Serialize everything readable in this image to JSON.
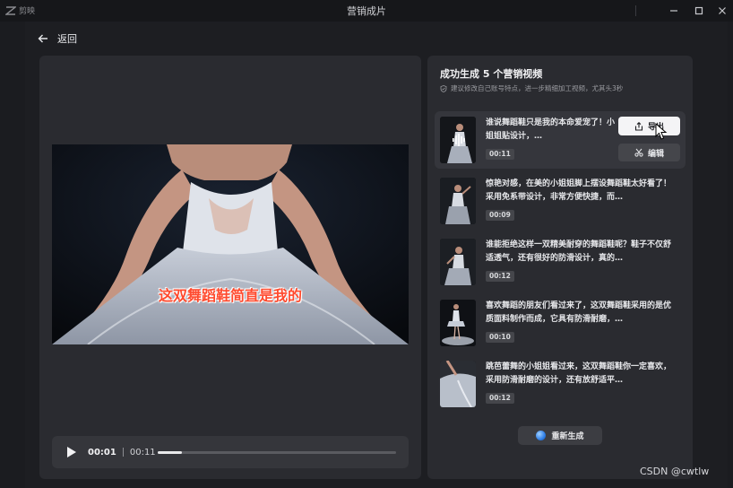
{
  "window": {
    "app_name": "剪映",
    "title": "营销成片",
    "controls": [
      "minimize-icon",
      "maximize-icon",
      "close-icon"
    ]
  },
  "nav": {
    "back_label": "返回"
  },
  "preview": {
    "subtitle": "这双舞蹈鞋简直是我的",
    "current_time": "00:01",
    "total_time": "00:11",
    "progress": 0.1
  },
  "results": {
    "title": "成功生成 5 个营销视频",
    "tip": "建议修改自己账号特点，进一步精细加工视频，尤其头3秒",
    "items": [
      {
        "text": "谁说舞蹈鞋只是我的本命爱宠了！小姐姐贴设计，…",
        "duration": "00:11",
        "active": true
      },
      {
        "text": "惊艳对感，在美的小姐姐脚上摆设舞蹈鞋太好看了！采用免系带设计，非常方便快捷，而…",
        "duration": "00:09",
        "active": false
      },
      {
        "text": "谁能拒绝这样一双精美耐穿的舞蹈鞋呢？鞋子不仅舒适透气，还有很好的防滑设计，真的…",
        "duration": "00:12",
        "active": false
      },
      {
        "text": "喜欢舞蹈的朋友们看过来了，这双舞蹈鞋采用的是优质面料制作而成，它具有防滑耐磨，…",
        "duration": "00:10",
        "active": false
      },
      {
        "text": "跳芭蕾舞的小姐姐看过来，这双舞蹈鞋你一定喜欢，采用防滑耐磨的设计，还有放舒适平…",
        "duration": "00:12",
        "active": false
      }
    ],
    "export_label": "导出",
    "edit_label": "编辑",
    "regenerate_label": "重新生成"
  },
  "watermark": "CSDN @cwtlw",
  "colors": {
    "background": "#1d1e22",
    "panel": "#2a2b30",
    "subtitle": "#ff4a2e",
    "accent": "#2f7fe8"
  }
}
